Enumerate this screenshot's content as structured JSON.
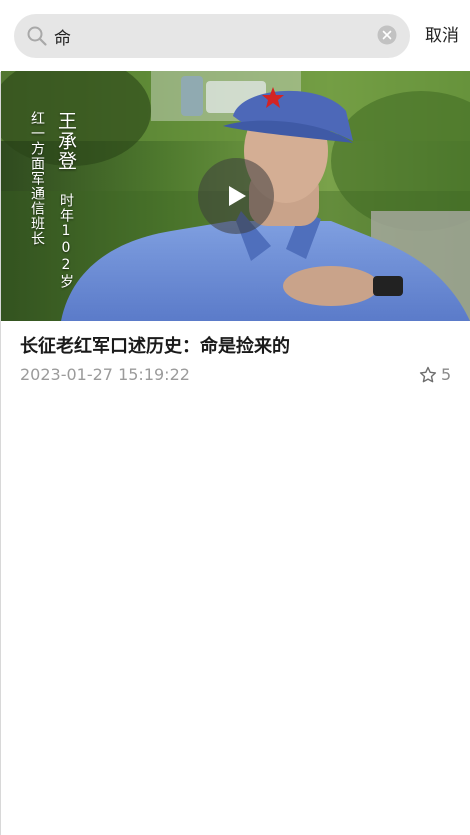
{
  "search": {
    "value": "命",
    "cancel_label": "取消"
  },
  "results": [
    {
      "title": "长征老红军口述历史：命是捡来的",
      "time": "2023-01-27 15:19:22",
      "favorites": "5",
      "thumbnail": {
        "caption_name": "王承登",
        "caption_unit": "红一方面军通信班长",
        "caption_age": "时年102岁"
      }
    }
  ],
  "icons": {
    "search": "search-icon",
    "clear": "clear-icon",
    "play": "play-icon",
    "favorite": "star-icon"
  },
  "colors": {
    "search_box_bg": "#e6e6e6",
    "meta_text": "#9b9b9b",
    "title_text": "#1a1a1a"
  }
}
